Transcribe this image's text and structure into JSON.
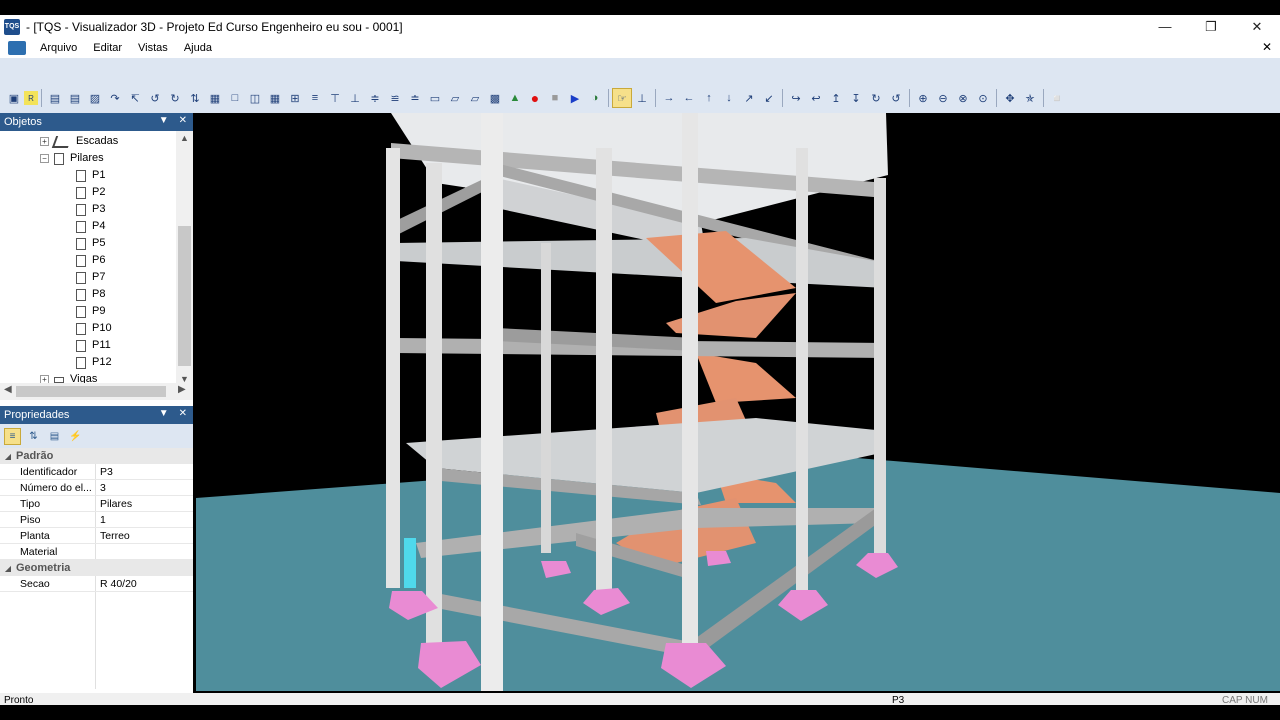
{
  "window": {
    "title": "- [TQS - Visualizador 3D - Projeto Ed Curso Engenheiro eu sou - 0001]",
    "app_icon": "TQS"
  },
  "menu": {
    "items": [
      "Arquivo",
      "Editar",
      "Vistas",
      "Ajuda"
    ]
  },
  "objetos_panel": {
    "title": "Objetos",
    "tree": [
      {
        "label": "Escadas",
        "toggle": "+"
      },
      {
        "label": "Pilares",
        "toggle": "−"
      },
      {
        "label": "P1"
      },
      {
        "label": "P2"
      },
      {
        "label": "P3"
      },
      {
        "label": "P4"
      },
      {
        "label": "P5"
      },
      {
        "label": "P6"
      },
      {
        "label": "P7"
      },
      {
        "label": "P8"
      },
      {
        "label": "P9"
      },
      {
        "label": "P10"
      },
      {
        "label": "P11"
      },
      {
        "label": "P12"
      },
      {
        "label": "Vigas",
        "toggle": "+"
      }
    ]
  },
  "propriedades_panel": {
    "title": "Propriedades",
    "categories": [
      {
        "name": "Padrão",
        "rows": [
          {
            "key": "Identificador",
            "value": "P3"
          },
          {
            "key": "Número do el...",
            "value": "3"
          },
          {
            "key": "Tipo",
            "value": "Pilares"
          },
          {
            "key": "Piso",
            "value": "1"
          },
          {
            "key": "Planta",
            "value": "Terreo"
          },
          {
            "key": "Material",
            "value": ""
          }
        ]
      },
      {
        "name": "Geometria",
        "rows": [
          {
            "key": "Secao",
            "value": "R 40/20"
          }
        ]
      }
    ]
  },
  "statusbar": {
    "left": "Pronto",
    "center": "P3",
    "right": "CAP NUM"
  },
  "colors": {
    "accent": "#2d5a8c",
    "toolbar_bg": "#dde6f2",
    "ground": "#4f8e9c",
    "slab": "#cfd2d5",
    "column": "#e6e6e6",
    "beam": "#a8a8a8",
    "stair": "#e6936e",
    "footing": "#e98bd3"
  }
}
